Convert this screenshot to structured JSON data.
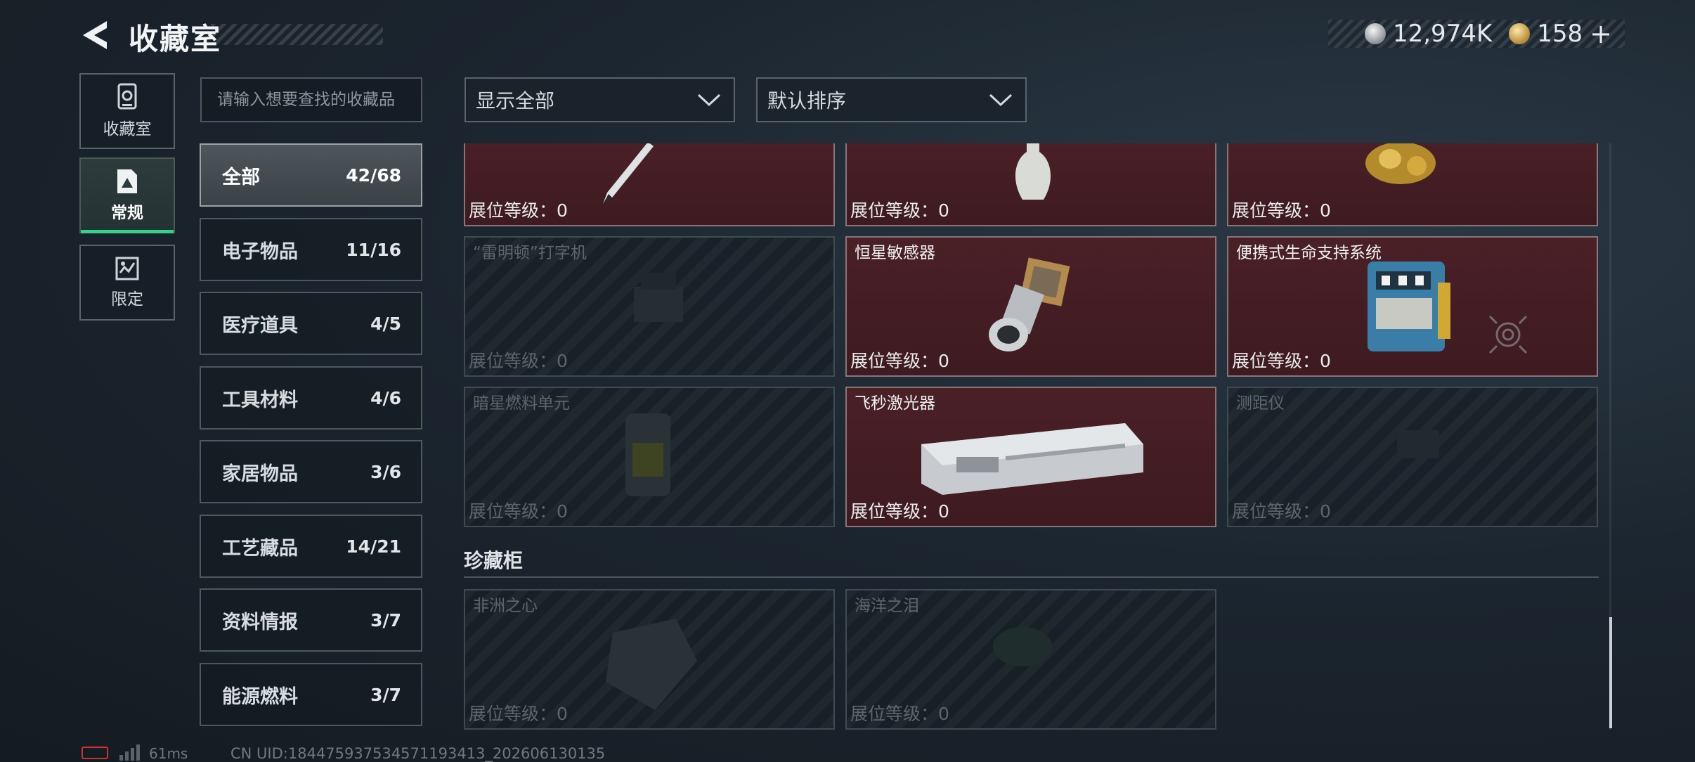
{
  "header": {
    "title": "收藏室"
  },
  "currency": {
    "silver": "12,974K",
    "gold": "158",
    "plus": "+"
  },
  "side_tabs": [
    {
      "label": "收藏室",
      "icon": "trophy-icon"
    },
    {
      "label": "常规",
      "icon": "picture-icon",
      "active": true
    },
    {
      "label": "限定",
      "icon": "map-icon"
    }
  ],
  "search": {
    "placeholder": "请输入想要查找的收藏品"
  },
  "categories": [
    {
      "name": "全部",
      "count": "42/68",
      "active": true
    },
    {
      "name": "电子物品",
      "count": "11/16"
    },
    {
      "name": "医疗道具",
      "count": "4/5"
    },
    {
      "name": "工具材料",
      "count": "4/6"
    },
    {
      "name": "家居物品",
      "count": "3/6"
    },
    {
      "name": "工艺藏品",
      "count": "14/21"
    },
    {
      "name": "资料情报",
      "count": "3/7"
    },
    {
      "name": "能源燃料",
      "count": "3/7"
    }
  ],
  "filters": {
    "show": "显示全部",
    "sort": "默认排序"
  },
  "items": [
    {
      "name": "",
      "level_label": "展位等级：",
      "level": "0",
      "owned": true,
      "icon": "pen-icon"
    },
    {
      "name": "",
      "level_label": "展位等级：",
      "level": "0",
      "owned": true,
      "icon": "vase-icon"
    },
    {
      "name": "",
      "level_label": "展位等级：",
      "level": "0",
      "owned": true,
      "icon": "gold-statue-icon"
    },
    {
      "name": "“雷明顿”打字机",
      "level_label": "展位等级：",
      "level": "0",
      "owned": false,
      "icon": "typewriter-icon"
    },
    {
      "name": "恒星敏感器",
      "level_label": "展位等级：",
      "level": "0",
      "owned": true,
      "icon": "star-sensor-icon"
    },
    {
      "name": "便携式生命支持系统",
      "level_label": "展位等级：",
      "level": "0",
      "owned": true,
      "icon": "life-support-icon"
    },
    {
      "name": "暗星燃料单元",
      "level_label": "展位等级：",
      "level": "0",
      "owned": false,
      "icon": "fuel-cell-icon"
    },
    {
      "name": "飞秒激光器",
      "level_label": "展位等级：",
      "level": "0",
      "owned": true,
      "icon": "laser-icon"
    },
    {
      "name": "测距仪",
      "level_label": "展位等级：",
      "level": "0",
      "owned": false,
      "icon": "rangefinder-icon"
    }
  ],
  "showcase": {
    "title": "珍藏柜",
    "items": [
      {
        "name": "非洲之心",
        "level_label": "展位等级：",
        "level": "0",
        "owned": false,
        "icon": "diamond-icon"
      },
      {
        "name": "海洋之泪",
        "level_label": "展位等级：",
        "level": "0",
        "owned": false,
        "icon": "gem-icon"
      }
    ]
  },
  "footer": {
    "ping": "61ms",
    "uid": "CN UID:1844759375345711934​13_202606130135"
  }
}
